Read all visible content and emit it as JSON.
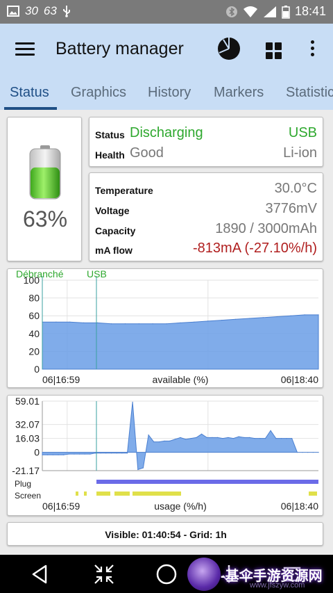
{
  "status_bar": {
    "left_indicators": [
      "30",
      "63"
    ],
    "time": "18:41"
  },
  "app_bar": {
    "title": "Battery manager",
    "icons": [
      "menu-icon",
      "pie-chart-icon",
      "grid-icon",
      "more-vert-icon"
    ]
  },
  "tabs": [
    {
      "label": "Status",
      "active": true
    },
    {
      "label": "Graphics",
      "active": false
    },
    {
      "label": "History",
      "active": false
    },
    {
      "label": "Markers",
      "active": false
    },
    {
      "label": "Statistics",
      "active": false
    }
  ],
  "battery": {
    "percent_label": "63%",
    "level": 0.63
  },
  "status_card": {
    "status_label": "Status",
    "status_value": "Discharging",
    "plug_value": "USB",
    "health_label": "Health",
    "health_value": "Good",
    "tech_value": "Li-ion"
  },
  "info_card": {
    "temperature_label": "Temperature",
    "temperature_value": "30.0°C",
    "voltage_label": "Voltage",
    "voltage_value": "3776mV",
    "capacity_label": "Capacity",
    "capacity_value": "1890 / 3000mAh",
    "maflow_label": "mA flow",
    "maflow_value": "-813mA (-27.10%/h)"
  },
  "chart_data": [
    {
      "type": "area",
      "markers": [
        {
          "label": "Débranché",
          "color": "#2ea82e"
        },
        {
          "label": "USB",
          "color": "#2ea82e"
        }
      ],
      "y_ticks": [
        "100",
        "80",
        "60",
        "40",
        "20",
        "0"
      ],
      "ylim": [
        0,
        100
      ],
      "x_start_label": "06|16:59",
      "x_end_label": "06|18:40",
      "xlabel": "available (%)",
      "series": [
        {
          "values": [
            53,
            53,
            53,
            52,
            52,
            51,
            51,
            51,
            51,
            51,
            52,
            53,
            54,
            55,
            56,
            57,
            58,
            59,
            60,
            61,
            61
          ]
        }
      ],
      "fill_color": "#6a9de6"
    },
    {
      "type": "area",
      "y_ticks": [
        "59.01",
        "32.07",
        "16.03",
        "0",
        "-21.17"
      ],
      "ylim": [
        -21.17,
        59.01
      ],
      "x_start_label": "06|16:59",
      "x_end_label": "06|18:40",
      "xlabel": "usage (%/h)",
      "series": [
        {
          "values": [
            -3,
            -3,
            -3,
            -3,
            -3,
            -2,
            -2,
            -2,
            -2,
            -2,
            -1,
            -1,
            -1,
            -1,
            -1,
            -1,
            -1,
            58,
            -20,
            -18,
            20,
            12,
            12,
            13,
            13,
            15,
            17,
            15,
            16,
            17,
            21,
            17,
            17,
            17,
            16,
            17,
            16,
            18,
            17,
            17,
            16,
            16,
            16,
            25,
            16,
            16,
            16,
            16,
            0,
            0,
            0,
            0,
            0
          ]
        }
      ],
      "fill_color": "#6a9de6",
      "rows": [
        {
          "label": "Plug",
          "color": "#6b6be8"
        },
        {
          "label": "Screen",
          "color": "#e0e04a"
        }
      ]
    }
  ],
  "footer": {
    "text": "Visible: 01:40:54 - Grid: 1h"
  },
  "nav_bar": {
    "buttons": [
      "back-icon",
      "collapse-icon",
      "home-icon",
      "recents-icon"
    ],
    "watermark": "-基伞手游资源网",
    "watermark_url": "www.jfszyw.com"
  }
}
